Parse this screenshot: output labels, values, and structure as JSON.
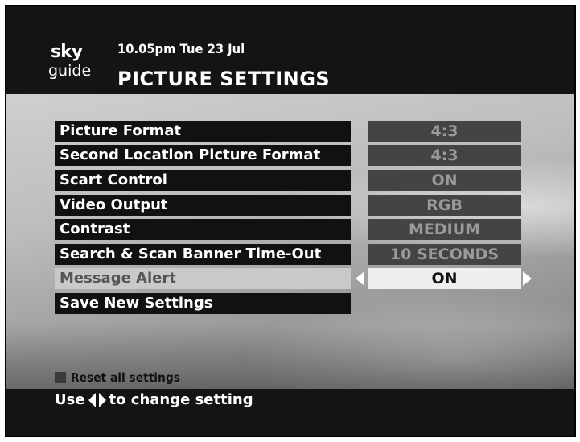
{
  "header": {
    "logo_top": "sky",
    "logo_bottom": "guide",
    "datetime": "10.05pm Tue 23 Jul",
    "title": "PICTURE SETTINGS"
  },
  "settings": [
    {
      "label": "Picture Format",
      "value": "4:3"
    },
    {
      "label": "Second Location Picture Format",
      "value": "4:3"
    },
    {
      "label": "Scart Control",
      "value": "ON"
    },
    {
      "label": "Video Output",
      "value": "RGB"
    },
    {
      "label": "Contrast",
      "value": "MEDIUM"
    },
    {
      "label": "Search & Scan Banner Time-Out",
      "value": "10 SECONDS"
    },
    {
      "label": "Message Alert",
      "value": "ON",
      "selected": true
    }
  ],
  "save_label": "Save New Settings",
  "reset_label": "Reset all settings",
  "footer": {
    "prefix": "Use",
    "suffix": "to change setting",
    "icon": "left-right-arrows-icon"
  },
  "colors": {
    "background": "#141414",
    "selected_label_bg": "#c9c9c9",
    "selected_value_bg": "#efefef",
    "value_bg": "#444444"
  }
}
